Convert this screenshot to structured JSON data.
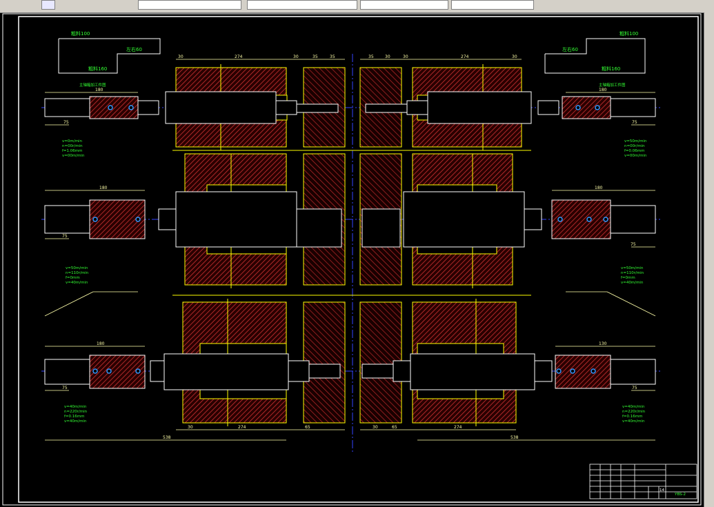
{
  "toolbar": {
    "items": [
      "",
      "",
      "",
      "",
      ""
    ],
    "item5_label": "",
    "item6_label": ""
  },
  "drawing": {
    "title_block_line1": "",
    "title_block_line2": "",
    "drawing_number": "YBS-2",
    "sheet_num": "14",
    "colors": {
      "border": "#ffffff",
      "outline": "#ffff00",
      "dimension": "#ffffaa",
      "hatch": "#cc3333",
      "centerline": "#3333ff",
      "text_green": "#33ff33",
      "text_white": "#ffffff"
    },
    "left_top": {
      "box_label": "粗料100",
      "box_label2": "粗料160",
      "step_label": "左右60",
      "spindle_label": "主轴箱加工件图",
      "params": [
        "v=0m/min",
        "n=00r/min",
        "f=1.06mm",
        "v=00m/min"
      ]
    },
    "right_top": {
      "box_label": "粗料100",
      "box_label2": "粗料160",
      "step_label": "左右60",
      "spindle_label": "主轴箱加工件图",
      "params": [
        "v=50m/min",
        "n=00r/min",
        "f=0.06mm",
        "v=00m/min"
      ]
    },
    "left_mid_params": [
      "v=50m/min",
      "n=110r/min",
      "f=0mm",
      "v=40m/min"
    ],
    "right_mid_params": [
      "v=50m/min",
      "n=110r/min",
      "f=0mm",
      "v=40m/min"
    ],
    "left_bot_params": [
      "v=40m/min",
      "n=220r/min",
      "f=0.16mm",
      "v=40m/min"
    ],
    "right_bot_params": [
      "v=40m/min",
      "n=220r/min",
      "f=0.16mm",
      "v=40m/min"
    ],
    "dim_top_left": [
      "30",
      "274",
      "30",
      "35",
      "35"
    ],
    "dim_top_right": [
      "35",
      "30",
      "30",
      "274",
      "30"
    ],
    "dim_bot_left": [
      "30",
      "274",
      "65"
    ],
    "dim_bot_right": [
      "30",
      "65",
      "274"
    ],
    "dim_overall_left": "538",
    "dim_overall_right": "538",
    "dim_left_spindle": [
      "180",
      "180",
      "180"
    ],
    "dim_right_spindle": [
      "180",
      "180",
      "130"
    ],
    "dim_small": [
      "75",
      "75",
      "75",
      "75",
      "75",
      "75"
    ]
  }
}
